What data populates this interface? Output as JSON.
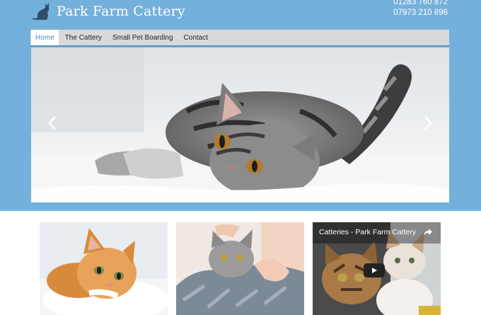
{
  "site": {
    "title": "Park Farm Cattery",
    "phone_1": "01283 760 872",
    "phone_2": "07973 210 896"
  },
  "nav": {
    "items": [
      {
        "label": "Home",
        "active": true
      },
      {
        "label": "The Cattery",
        "active": false
      },
      {
        "label": "Small Pet Boarding",
        "active": false
      },
      {
        "label": "Contact",
        "active": false
      }
    ]
  },
  "video": {
    "title": "Catteries - Park Farm Cattery"
  },
  "colors": {
    "header_bg": "#74b0dc",
    "nav_bg": "#d9d9d9",
    "nav_active_text": "#4a8fc4"
  },
  "icons": {
    "logo": "cat-silhouette-icon",
    "carousel_prev": "chevron-left-icon",
    "carousel_next": "chevron-right-icon",
    "share": "share-icon",
    "play": "play-icon"
  }
}
